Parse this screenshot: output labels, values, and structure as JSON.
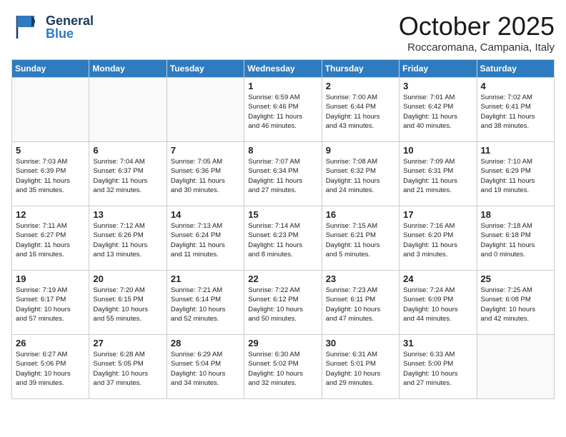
{
  "header": {
    "logo_general": "General",
    "logo_blue": "Blue",
    "month": "October 2025",
    "location": "Roccaromana, Campania, Italy"
  },
  "weekdays": [
    "Sunday",
    "Monday",
    "Tuesday",
    "Wednesday",
    "Thursday",
    "Friday",
    "Saturday"
  ],
  "weeks": [
    [
      {
        "day": "",
        "info": ""
      },
      {
        "day": "",
        "info": ""
      },
      {
        "day": "",
        "info": ""
      },
      {
        "day": "1",
        "info": "Sunrise: 6:59 AM\nSunset: 6:46 PM\nDaylight: 11 hours\nand 46 minutes."
      },
      {
        "day": "2",
        "info": "Sunrise: 7:00 AM\nSunset: 6:44 PM\nDaylight: 11 hours\nand 43 minutes."
      },
      {
        "day": "3",
        "info": "Sunrise: 7:01 AM\nSunset: 6:42 PM\nDaylight: 11 hours\nand 40 minutes."
      },
      {
        "day": "4",
        "info": "Sunrise: 7:02 AM\nSunset: 6:41 PM\nDaylight: 11 hours\nand 38 minutes."
      }
    ],
    [
      {
        "day": "5",
        "info": "Sunrise: 7:03 AM\nSunset: 6:39 PM\nDaylight: 11 hours\nand 35 minutes."
      },
      {
        "day": "6",
        "info": "Sunrise: 7:04 AM\nSunset: 6:37 PM\nDaylight: 11 hours\nand 32 minutes."
      },
      {
        "day": "7",
        "info": "Sunrise: 7:05 AM\nSunset: 6:36 PM\nDaylight: 11 hours\nand 30 minutes."
      },
      {
        "day": "8",
        "info": "Sunrise: 7:07 AM\nSunset: 6:34 PM\nDaylight: 11 hours\nand 27 minutes."
      },
      {
        "day": "9",
        "info": "Sunrise: 7:08 AM\nSunset: 6:32 PM\nDaylight: 11 hours\nand 24 minutes."
      },
      {
        "day": "10",
        "info": "Sunrise: 7:09 AM\nSunset: 6:31 PM\nDaylight: 11 hours\nand 21 minutes."
      },
      {
        "day": "11",
        "info": "Sunrise: 7:10 AM\nSunset: 6:29 PM\nDaylight: 11 hours\nand 19 minutes."
      }
    ],
    [
      {
        "day": "12",
        "info": "Sunrise: 7:11 AM\nSunset: 6:27 PM\nDaylight: 11 hours\nand 16 minutes."
      },
      {
        "day": "13",
        "info": "Sunrise: 7:12 AM\nSunset: 6:26 PM\nDaylight: 11 hours\nand 13 minutes."
      },
      {
        "day": "14",
        "info": "Sunrise: 7:13 AM\nSunset: 6:24 PM\nDaylight: 11 hours\nand 11 minutes."
      },
      {
        "day": "15",
        "info": "Sunrise: 7:14 AM\nSunset: 6:23 PM\nDaylight: 11 hours\nand 8 minutes."
      },
      {
        "day": "16",
        "info": "Sunrise: 7:15 AM\nSunset: 6:21 PM\nDaylight: 11 hours\nand 5 minutes."
      },
      {
        "day": "17",
        "info": "Sunrise: 7:16 AM\nSunset: 6:20 PM\nDaylight: 11 hours\nand 3 minutes."
      },
      {
        "day": "18",
        "info": "Sunrise: 7:18 AM\nSunset: 6:18 PM\nDaylight: 11 hours\nand 0 minutes."
      }
    ],
    [
      {
        "day": "19",
        "info": "Sunrise: 7:19 AM\nSunset: 6:17 PM\nDaylight: 10 hours\nand 57 minutes."
      },
      {
        "day": "20",
        "info": "Sunrise: 7:20 AM\nSunset: 6:15 PM\nDaylight: 10 hours\nand 55 minutes."
      },
      {
        "day": "21",
        "info": "Sunrise: 7:21 AM\nSunset: 6:14 PM\nDaylight: 10 hours\nand 52 minutes."
      },
      {
        "day": "22",
        "info": "Sunrise: 7:22 AM\nSunset: 6:12 PM\nDaylight: 10 hours\nand 50 minutes."
      },
      {
        "day": "23",
        "info": "Sunrise: 7:23 AM\nSunset: 6:11 PM\nDaylight: 10 hours\nand 47 minutes."
      },
      {
        "day": "24",
        "info": "Sunrise: 7:24 AM\nSunset: 6:09 PM\nDaylight: 10 hours\nand 44 minutes."
      },
      {
        "day": "25",
        "info": "Sunrise: 7:25 AM\nSunset: 6:08 PM\nDaylight: 10 hours\nand 42 minutes."
      }
    ],
    [
      {
        "day": "26",
        "info": "Sunrise: 6:27 AM\nSunset: 5:06 PM\nDaylight: 10 hours\nand 39 minutes."
      },
      {
        "day": "27",
        "info": "Sunrise: 6:28 AM\nSunset: 5:05 PM\nDaylight: 10 hours\nand 37 minutes."
      },
      {
        "day": "28",
        "info": "Sunrise: 6:29 AM\nSunset: 5:04 PM\nDaylight: 10 hours\nand 34 minutes."
      },
      {
        "day": "29",
        "info": "Sunrise: 6:30 AM\nSunset: 5:02 PM\nDaylight: 10 hours\nand 32 minutes."
      },
      {
        "day": "30",
        "info": "Sunrise: 6:31 AM\nSunset: 5:01 PM\nDaylight: 10 hours\nand 29 minutes."
      },
      {
        "day": "31",
        "info": "Sunrise: 6:33 AM\nSunset: 5:00 PM\nDaylight: 10 hours\nand 27 minutes."
      },
      {
        "day": "",
        "info": ""
      }
    ]
  ]
}
